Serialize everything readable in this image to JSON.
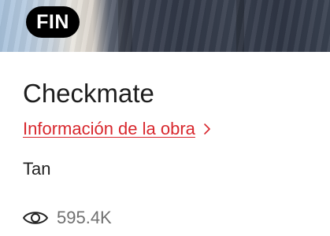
{
  "cover": {
    "badge_label": "FIN",
    "image": "series-cover-art"
  },
  "work": {
    "title": "Checkmate",
    "info_link_label": "Información de la obra",
    "info_link_icon": "chevron-right-icon",
    "author": "Tan",
    "views_icon": "eye-icon",
    "views_count": "595.4K"
  },
  "colors": {
    "link": "#d8272d",
    "badge_bg": "#000000",
    "muted_text": "#707070"
  }
}
